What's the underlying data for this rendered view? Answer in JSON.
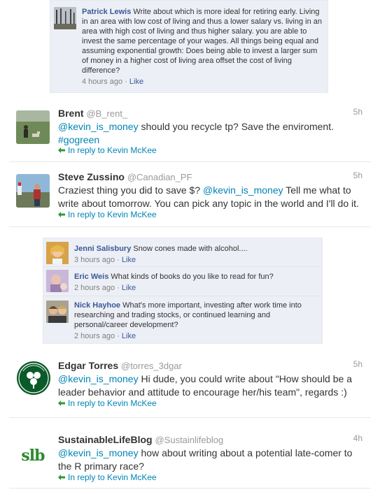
{
  "top_comment": {
    "name": "Patrick Lewis",
    "text": "Write about which is more ideal for retiring early. Living in an area with low cost of living and thus a lower salary vs. living in an area with high cost of living and thus higher salary. you are able to invest the same percentage of your wages. All things being equal and assuming exponential growth: Does being able to invest a larger sum of money in a higher cost of living area offset the cost of living difference?",
    "time": "4 hours ago",
    "dot": "·",
    "like": "Like"
  },
  "tweets": [
    {
      "name": "Brent",
      "handle": "@B_rent_",
      "time": "5h",
      "mention": "@kevin_is_money",
      "text": " should you recycle tp? Save the enviroment. ",
      "hashtag": "#gogreen",
      "reply": "In reply to Kevin McKee"
    },
    {
      "name": "Steve Zussino",
      "handle": "@Canadian_PF",
      "time": "5h",
      "text_before": "Craziest thing you did to save $? ",
      "mention": "@kevin_is_money",
      "text": " Tell me what to write about tomorrow. You can pick any topic in the world and I'll do it.",
      "reply": "In reply to Kevin McKee"
    },
    {
      "name": "Edgar Torres",
      "handle": "@torres_3dgar",
      "time": "5h",
      "mention": "@kevin_is_money",
      "text": " Hi dude, you could write about \"How should be a leader behavior and attitude to encourage her/his team\", regards :)",
      "reply": "In reply to Kevin McKee"
    },
    {
      "name": "SustainableLifeBlog",
      "handle": "@Sustainlifeblog",
      "time": "4h",
      "logo_text": "slb",
      "mention": "@kevin_is_money",
      "text": " how about writing about a potential late-comer to the R primary race?",
      "reply": "In reply to Kevin McKee"
    }
  ],
  "fb_comments": [
    {
      "name": "Jenni Salisbury",
      "text": "Snow cones made with alcohol....",
      "time": "3 hours ago",
      "dot": "·",
      "like": "Like"
    },
    {
      "name": "Eric Weis",
      "text": "What kinds of books do you like to read for fun?",
      "time": "2 hours ago",
      "dot": "·",
      "like": "Like"
    },
    {
      "name": "Nick Hayhoe",
      "text": "What's more important, investing after work time into researching and trading stocks, or continued learning and personal/career development?",
      "time": "2 hours ago",
      "dot": "·",
      "like": "Like"
    }
  ],
  "colors": {
    "fb_link": "#3b5998",
    "tw_link": "#0084b4",
    "fb_box_bg": "#eceff5",
    "celtics_green": "#007a33",
    "slb_green": "#2e8b2e"
  },
  "icons": [
    "reply-arrow-icon"
  ]
}
